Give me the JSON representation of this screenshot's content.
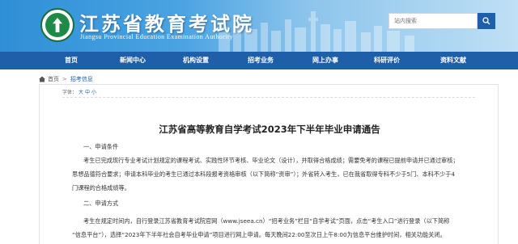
{
  "header": {
    "site_title": "江苏省教育考试院",
    "site_subtitle": "Jiangsu Provincial Education Examination Authority",
    "search_placeholder": "站内搜索"
  },
  "nav": {
    "items": [
      {
        "label": "首页"
      },
      {
        "label": "新闻中心"
      },
      {
        "label": "机构设置"
      },
      {
        "label": "招考业务"
      },
      {
        "label": "网上办事"
      },
      {
        "label": "科研评价"
      },
      {
        "label": "资料文献"
      }
    ]
  },
  "breadcrumb": {
    "home": "首页",
    "current": "招考信息",
    "separator": ">"
  },
  "article": {
    "font_size_label": "字体：",
    "font_size_options": [
      "大",
      "中",
      "小"
    ],
    "title": "江苏省高等教育自学考试2023年下半年毕业申请通告",
    "section1_heading": "一、申请条件",
    "section1_lines": [
      "考生已完成现行专业考试计划规定的课程考试、实践性环节考核、毕业论文（设计），并取得合格成绩；需要免考的课程已提前申请并已通过审核；",
      "思想品德符合要求；申请本科毕业的考生已通过本科段报考资格审核（以下简称“资审”）；外省转入考生，已在我省取得专科不少于5门、本科不少于4",
      "门课程的合格成绩等。"
    ],
    "section2_heading": "二、申请方式",
    "section2_lines": [
      "考生在规定时间内，自行登录江苏省教育考试院官网（www.jseea.cn）“招考业务”栏目“自学考试”页面，点击“考生入口”进行登录（以下简称",
      "“信息平台”），选择“2023年下半年社会自考毕业申请”项目进行网上申请。每天晚间22:00至次日上午8:00为信息平台维护时间，相关功能关闭。"
    ]
  },
  "colors": {
    "nav_bg": "#1f5fa9",
    "header_gradient_start": "#2f8fd6",
    "logo_green": "#1f8a47"
  },
  "icons": [
    "emblem-logo",
    "search-icon",
    "home-icon"
  ]
}
